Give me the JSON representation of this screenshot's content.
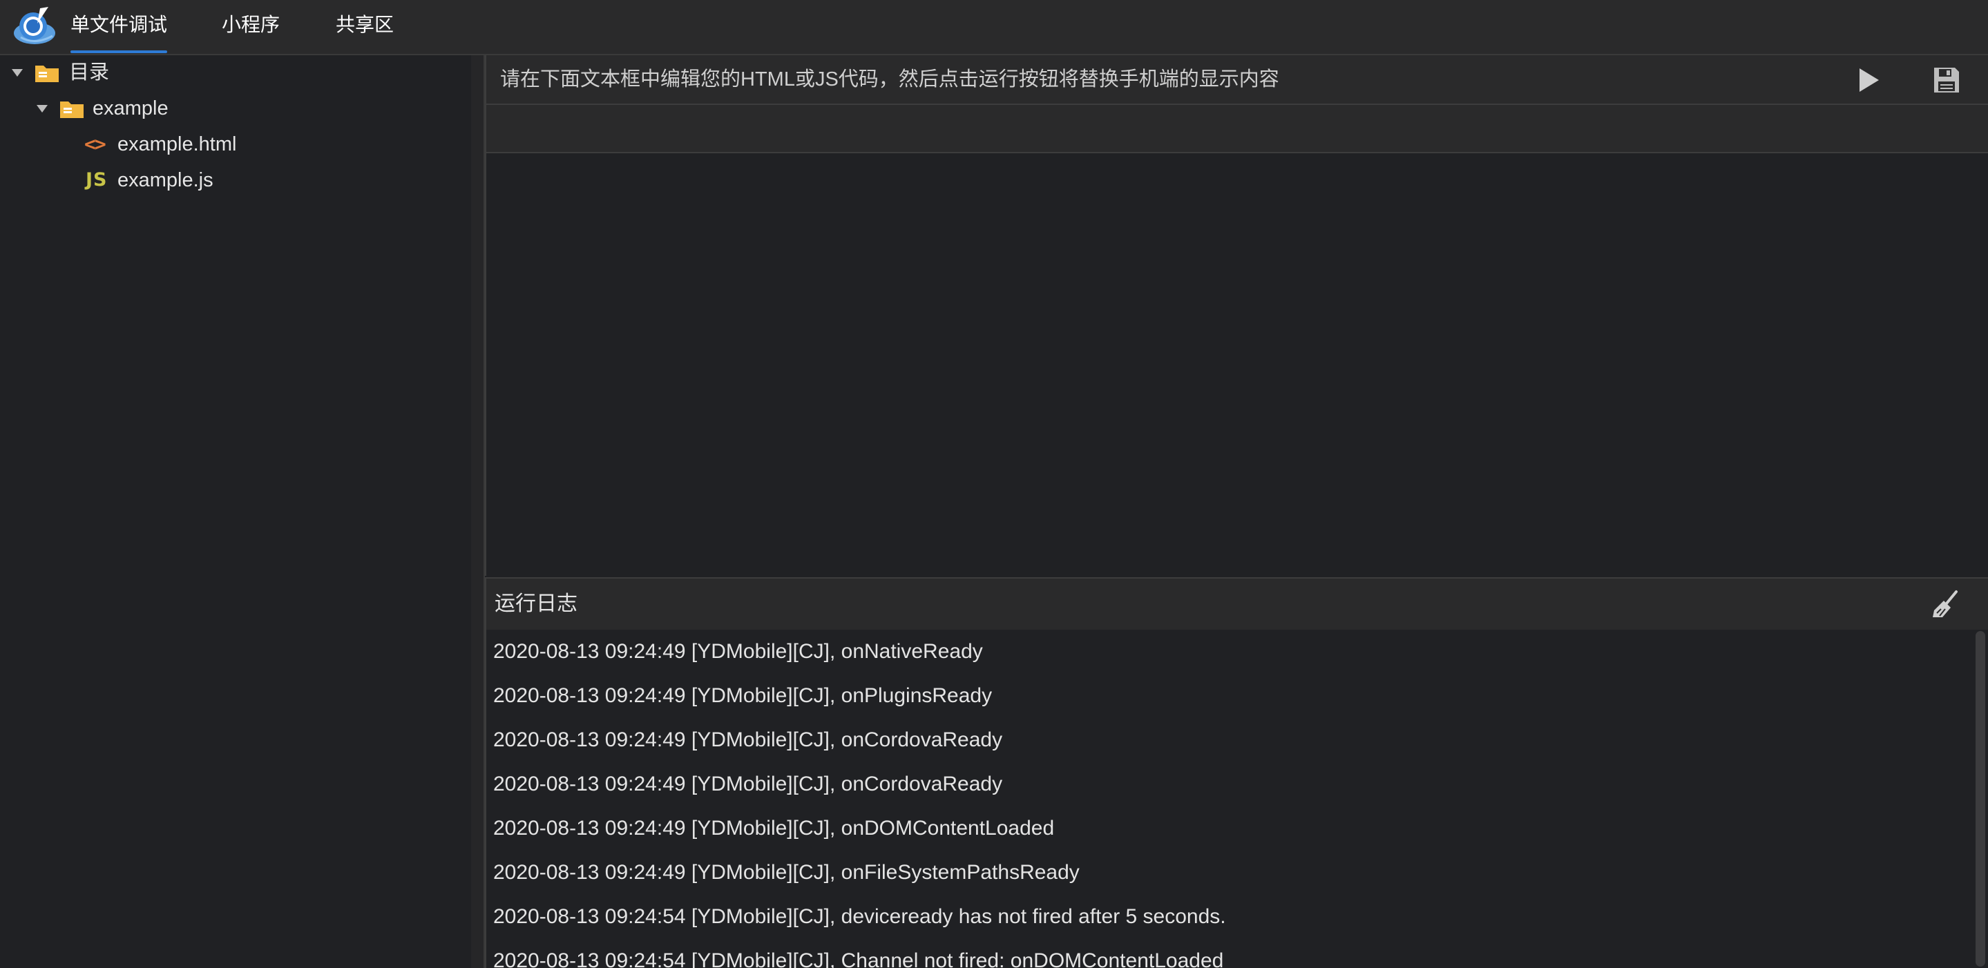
{
  "header": {
    "tabs": [
      {
        "label": "单文件调试",
        "active": true
      },
      {
        "label": "小程序",
        "active": false
      },
      {
        "label": "共享区",
        "active": false
      }
    ],
    "accent_color": "#2e7bd6"
  },
  "sidebar": {
    "root": {
      "label": "目录",
      "icon": "folder-icon"
    },
    "folder": {
      "label": "example",
      "icon": "folder-icon"
    },
    "files": [
      {
        "label": "example.html",
        "icon": "html-file-icon",
        "badge": "<>"
      },
      {
        "label": "example.js",
        "icon": "js-file-icon",
        "badge": "JS"
      }
    ]
  },
  "editor": {
    "hint": "请在下面文本框中编辑您的HTML或JS代码，然后点击运行按钮将替换手机端的显示内容",
    "run_icon": "play-icon",
    "save_icon": "save-icon"
  },
  "log": {
    "title": "运行日志",
    "clear_icon": "broom-icon",
    "lines": [
      "2020-08-13 09:24:49 [YDMobile][CJ], onNativeReady",
      "2020-08-13 09:24:49 [YDMobile][CJ], onPluginsReady",
      "2020-08-13 09:24:49 [YDMobile][CJ], onCordovaReady",
      "2020-08-13 09:24:49 [YDMobile][CJ], onCordovaReady",
      "2020-08-13 09:24:49 [YDMobile][CJ], onDOMContentLoaded",
      "2020-08-13 09:24:49 [YDMobile][CJ], onFileSystemPathsReady",
      "2020-08-13 09:24:54 [YDMobile][CJ], deviceready has not fired after 5 seconds.",
      "2020-08-13 09:24:54 [YDMobile][CJ], Channel not fired: onDOMContentLoaded"
    ]
  }
}
